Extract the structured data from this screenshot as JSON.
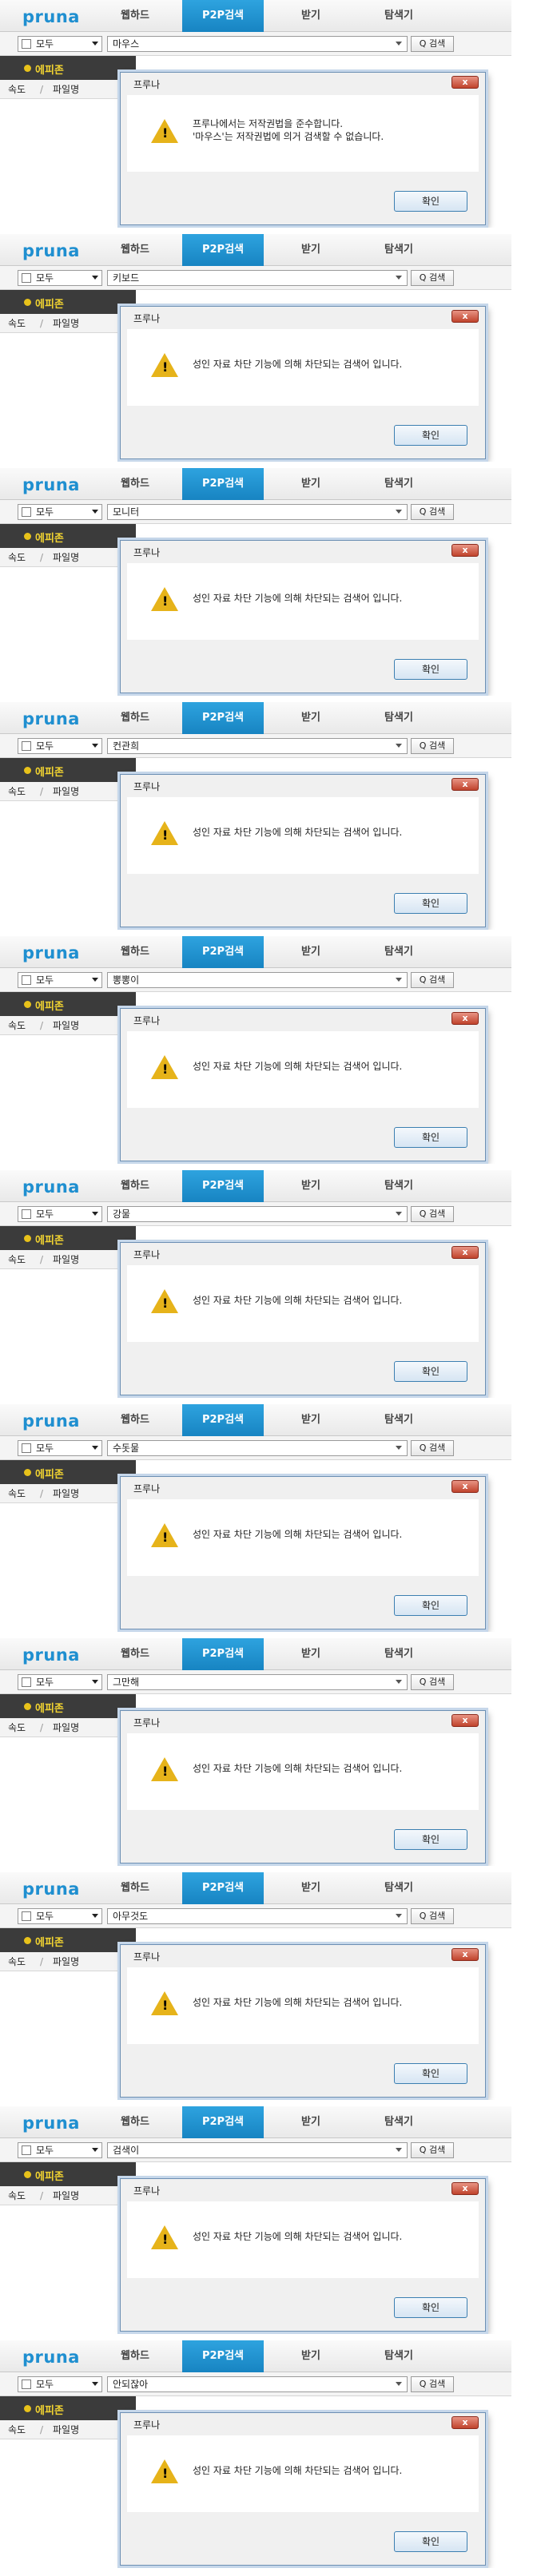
{
  "app": {
    "logo": "pruna",
    "tabs": [
      "웹하드",
      "P2P검색",
      "받기",
      "탐색기"
    ],
    "active_tab": "P2P검색",
    "scope_select": "모두",
    "search_button": "Q 검색",
    "side_label": "에피존",
    "col_speed": "속도",
    "col_sep": "/",
    "col_name": "파일명",
    "dialog_title": "프루나",
    "ok_button": "확인",
    "colors": {
      "brand": "#1f8fd0",
      "active_tab": "#2ea3df",
      "side_bg": "#3b3b3b",
      "side_text": "#f1d331",
      "warn": "#e6b31a"
    }
  },
  "panels": [
    {
      "query": "마우스",
      "message_lines": [
        "프루나에서는 저작권법을 준수합니다.",
        "'마우스'는 저작권법에 의거 검색할 수 없습니다."
      ]
    },
    {
      "query": "키보드",
      "message_lines": [
        "성인 자료 차단 기능에 의해 차단되는 검색어 입니다."
      ]
    },
    {
      "query": "모니터",
      "message_lines": [
        "성인 자료 차단 기능에 의해 차단되는 검색어 입니다."
      ]
    },
    {
      "query": "컨관희",
      "message_lines": [
        "성인 자료 차단 기능에 의해 차단되는 검색어 입니다."
      ]
    },
    {
      "query": "뽕뽕이",
      "message_lines": [
        "성인 자료 차단 기능에 의해 차단되는 검색어 입니다."
      ]
    },
    {
      "query": "강물",
      "message_lines": [
        "성인 자료 차단 기능에 의해 차단되는 검색어 입니다."
      ]
    },
    {
      "query": "수돗물",
      "message_lines": [
        "성인 자료 차단 기능에 의해 차단되는 검색어 입니다."
      ]
    },
    {
      "query": "그만해",
      "message_lines": [
        "성인 자료 차단 기능에 의해 차단되는 검색어 입니다."
      ]
    },
    {
      "query": "아무것도",
      "message_lines": [
        "성인 자료 차단 기능에 의해 차단되는 검색어 입니다."
      ]
    },
    {
      "query": "검색이",
      "message_lines": [
        "성인 자료 차단 기능에 의해 차단되는 검색어 입니다."
      ]
    },
    {
      "query": "안되잖아",
      "message_lines": [
        "성인 자료 차단 기능에 의해 차단되는 검색어 입니다."
      ]
    }
  ]
}
